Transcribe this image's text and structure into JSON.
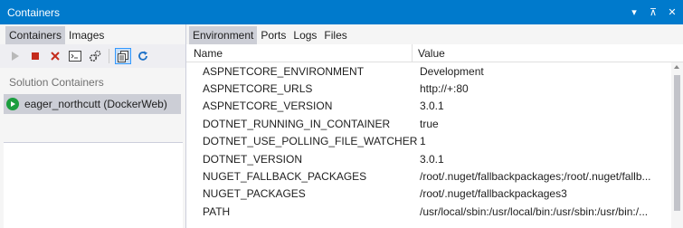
{
  "window": {
    "title": "Containers",
    "controls": {
      "menu_icon": "▾",
      "pin_icon": "⊼",
      "close_icon": "✕"
    }
  },
  "left": {
    "tabs": [
      {
        "label": "Containers",
        "active": true
      },
      {
        "label": "Images",
        "active": false
      }
    ],
    "toolbar": {
      "icons": [
        "start-icon",
        "stop-icon",
        "remove-icon",
        "terminal-icon",
        "settings-icon",
        "copy-files-icon",
        "refresh-icon"
      ]
    },
    "section_title": "Solution Containers",
    "containers": [
      {
        "label": "eager_northcutt (DockerWeb)",
        "status_color": "#1b9e3e"
      }
    ]
  },
  "right": {
    "tabs": [
      {
        "label": "Environment",
        "active": true
      },
      {
        "label": "Ports",
        "active": false
      },
      {
        "label": "Logs",
        "active": false
      },
      {
        "label": "Files",
        "active": false
      }
    ],
    "columns": {
      "name": "Name",
      "value": "Value"
    },
    "rows": [
      {
        "name": "ASPNETCORE_ENVIRONMENT",
        "value": "Development"
      },
      {
        "name": "ASPNETCORE_URLS",
        "value": "http://+:80"
      },
      {
        "name": "ASPNETCORE_VERSION",
        "value": "3.0.1"
      },
      {
        "name": "DOTNET_RUNNING_IN_CONTAINER",
        "value": "true"
      },
      {
        "name": "DOTNET_USE_POLLING_FILE_WATCHER",
        "value": "1"
      },
      {
        "name": "DOTNET_VERSION",
        "value": "3.0.1"
      },
      {
        "name": "NUGET_FALLBACK_PACKAGES",
        "value": "/root/.nuget/fallbackpackages;/root/.nuget/fallb..."
      },
      {
        "name": "NUGET_PACKAGES",
        "value": "/root/.nuget/fallbackpackages3"
      },
      {
        "name": "PATH",
        "value": "/usr/local/sbin:/usr/local/bin:/usr/sbin:/usr/bin:/..."
      }
    ]
  },
  "colors": {
    "accent": "#007acc",
    "selection": "#ccced6",
    "run_green": "#1b9e3e",
    "stop_red": "#c42b1c"
  }
}
